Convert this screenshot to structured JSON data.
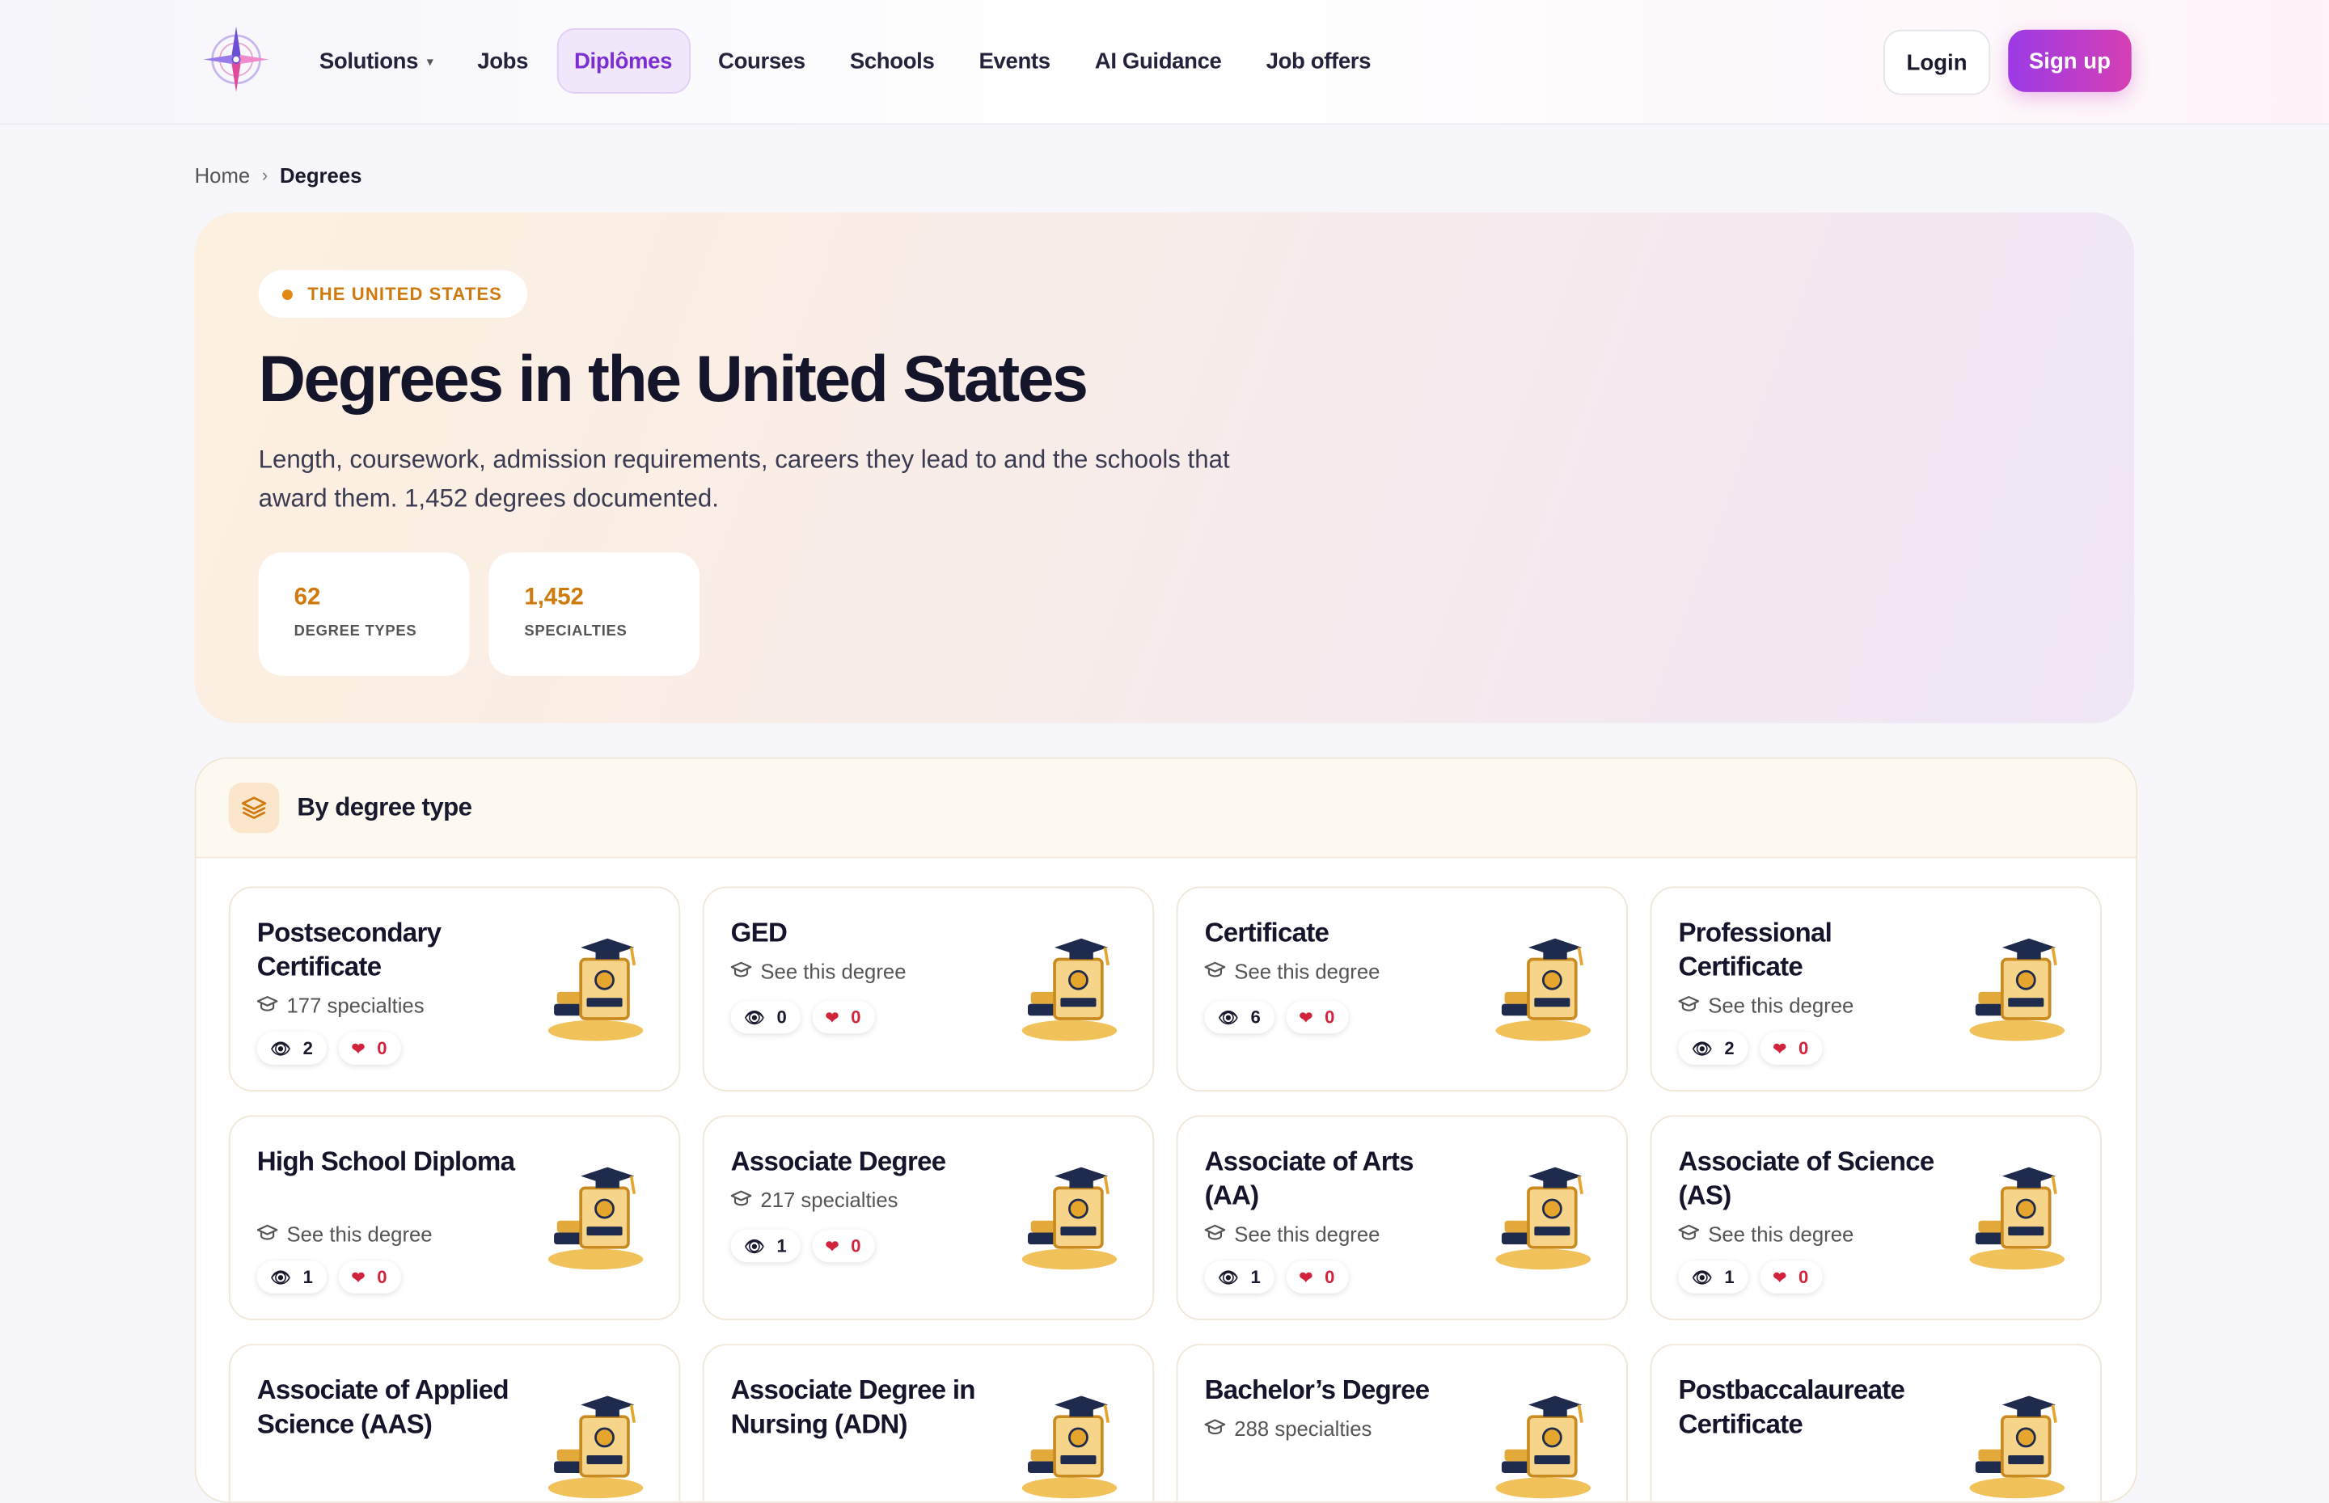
{
  "nav": {
    "items": [
      {
        "label": "Solutions",
        "has_caret": true
      },
      {
        "label": "Jobs"
      },
      {
        "label": "Diplômes",
        "active": true
      },
      {
        "label": "Courses"
      },
      {
        "label": "Schools"
      },
      {
        "label": "Events"
      },
      {
        "label": "AI Guidance"
      },
      {
        "label": "Job offers"
      }
    ],
    "login_label": "Login",
    "signup_label": "Sign up"
  },
  "breadcrumb": {
    "home": "Home",
    "separator": "›",
    "current": "Degrees"
  },
  "hero": {
    "country": "THE UNITED STATES",
    "title": "Degrees in the United States",
    "subtitle": "Length, coursework, admission requirements, careers they lead to and the schools that award them. 1,452 degrees documented.",
    "stats": [
      {
        "value": "62",
        "label": "DEGREE TYPES"
      },
      {
        "value": "1,452",
        "label": "SPECIALTIES"
      }
    ]
  },
  "section": {
    "title": "By degree type",
    "cards": [
      {
        "title": "Postsecondary Certificate",
        "sub": "177 specialties",
        "views": "2",
        "likes": "0"
      },
      {
        "title": "GED",
        "sub": "See this degree",
        "views": "0",
        "likes": "0"
      },
      {
        "title": "Certificate",
        "sub": "See this degree",
        "views": "6",
        "likes": "0"
      },
      {
        "title": "Professional Certificate",
        "sub": "See this degree",
        "views": "2",
        "likes": "0"
      },
      {
        "title": "High School Diploma",
        "sub": "See this degree",
        "views": "1",
        "likes": "0"
      },
      {
        "title": "Associate Degree",
        "sub": "217 specialties",
        "views": "1",
        "likes": "0"
      },
      {
        "title": "Associate of Arts (AA)",
        "sub": "See this degree",
        "views": "1",
        "likes": "0"
      },
      {
        "title": "Associate of Science (AS)",
        "sub": "See this degree",
        "views": "1",
        "likes": "0"
      },
      {
        "title": "Associate of Applied Science (AAS)",
        "sub": "",
        "views": "",
        "likes": ""
      },
      {
        "title": "Associate Degree in Nursing (ADN)",
        "sub": "",
        "views": "",
        "likes": ""
      },
      {
        "title": "Bachelor’s Degree",
        "sub": "288 specialties",
        "views": "",
        "likes": ""
      },
      {
        "title": "Postbaccalaureate Certificate",
        "sub": "",
        "views": "",
        "likes": ""
      }
    ]
  },
  "colors": {
    "accent_purple": "#7b2fd0",
    "accent_orange": "#d0790c",
    "like_red": "#d2233c"
  },
  "icons": [
    "compass-logo",
    "chevron-down-icon",
    "layers-icon",
    "graduation-cap-icon",
    "eye-icon",
    "heart-icon"
  ]
}
